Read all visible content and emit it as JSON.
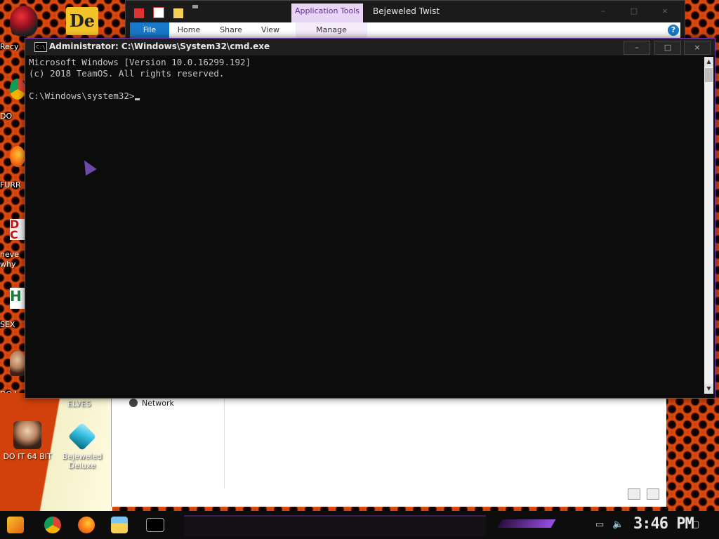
{
  "desktop": {
    "icons": [
      {
        "label": "Recy"
      },
      {
        "label": "DO"
      },
      {
        "label": "FURR"
      },
      {
        "label": "neve\nwhy"
      },
      {
        "label": "SEX"
      },
      {
        "label": "DO I"
      },
      {
        "label": "ELVES"
      },
      {
        "label": "DO IT 64 BIT"
      },
      {
        "label": "Bejeweled\nDeluxe"
      }
    ],
    "top_icon_text": "De"
  },
  "explorer": {
    "title": "Bejeweled Twist",
    "context_tab": "Application Tools",
    "ribbon_tabs": [
      "File",
      "Home",
      "Share",
      "View",
      "Manage"
    ],
    "nav_item": "Network",
    "help_icon": "?"
  },
  "cmd": {
    "title": "Administrator: C:\\Windows\\System32\\cmd.exe",
    "lines": [
      "Microsoft Windows [Version 10.0.16299.192]",
      "(c) 2018 TeamOS. All rights reserved.",
      "",
      "C:\\Windows\\system32>"
    ],
    "minimize": "–",
    "maximize": "□",
    "close": "×"
  },
  "taskbar": {
    "clock": "3:46 PM",
    "pinned": [
      "start-icon",
      "chrome-icon",
      "firefox-icon",
      "file-explorer-icon",
      "cmd-icon"
    ]
  },
  "colors": {
    "accent_purple": "#7a3fb0",
    "cmd_bg": "#0c0c0c",
    "file_tab": "#1979ca"
  }
}
